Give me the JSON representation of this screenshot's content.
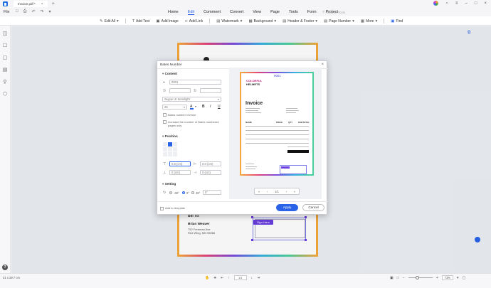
{
  "titlebar": {
    "tab_title": "Invoice.pdf *",
    "tab_close": "×",
    "tab_add": "+"
  },
  "menubar": {
    "file": "File",
    "items": [
      "Home",
      "Edit",
      "Comment",
      "Convert",
      "View",
      "Page",
      "Tools",
      "Form",
      "Protect"
    ],
    "active": "Edit",
    "search_placeholder": "Search Tools"
  },
  "toolbar": {
    "edit_all": "Edit All",
    "add_text": "Add Text",
    "add_image": "Add Image",
    "add_link": "Add Link",
    "watermark": "Watermark",
    "background": "Background",
    "header_footer": "Header & Footer",
    "page_number": "Page Number",
    "more": "More",
    "find": "Find"
  },
  "document": {
    "bill_to": "Bill To:",
    "name": "Brian Weaver",
    "address_lines": [
      "752 Freeman Ave",
      "Red Wing, MN 55066"
    ],
    "sign_here": "Sign Here"
  },
  "dialog": {
    "title": "Bates Number",
    "close": "×",
    "content_label": "Content",
    "bates_value": "0001",
    "font": "Segoe UI Semilight",
    "font_size": "26",
    "reverse_label": "Bates number reverse",
    "increase_label": "Increase the number of Bates numbered pages only",
    "position_label": "Position",
    "pos_top": "0.5 (cm)",
    "pos_right": "0.0 (cm)",
    "pos_bottom": "0 (cm)",
    "pos_left": "0 (cm)",
    "setting_label": "Setting",
    "rotations": [
      "-45°",
      "0°",
      "45°"
    ],
    "rotation_selected": "0°",
    "rotation_value": "0°",
    "add_template": "Add to template",
    "apply": "Apply",
    "cancel": "Cancel",
    "format_buttons": [
      "B",
      "I",
      "U"
    ],
    "preview": {
      "bates": "0001",
      "logo_line1": "COLORFUL",
      "logo_line2": "HELMETS",
      "invoice": "Invoice",
      "headers": [
        "NAME",
        "PRICE",
        "QTY",
        "SUBTOTAL"
      ],
      "page_current": "1",
      "page_total": "/1"
    }
  },
  "statusbar": {
    "dimensions": "21 x 29.7 cm",
    "page_field": "1/1",
    "zoom": "73%"
  }
}
